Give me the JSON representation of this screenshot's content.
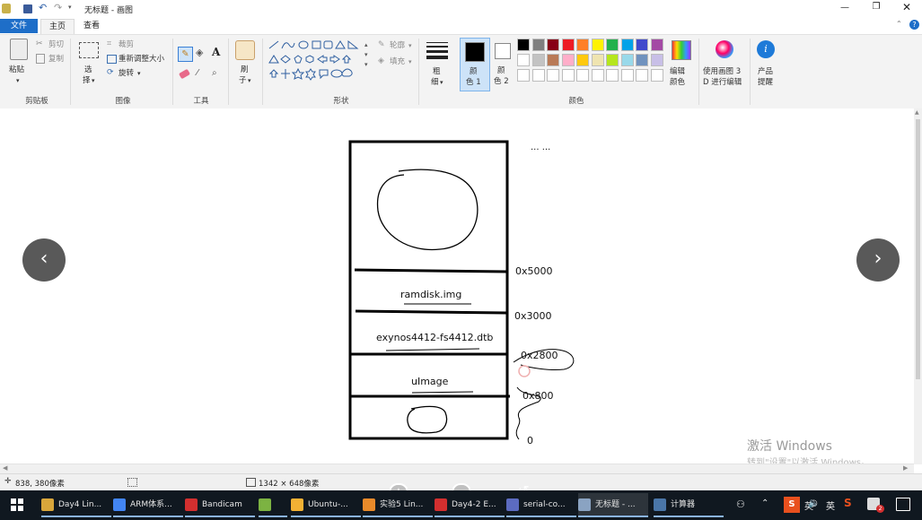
{
  "window": {
    "title": "无标题 - 画图"
  },
  "tabs": [
    {
      "label": "文件"
    },
    {
      "label": "主页"
    },
    {
      "label": "查看"
    }
  ],
  "ribbon": {
    "clipboard": {
      "paste": "粘贴",
      "cut": "剪切",
      "copy": "复制",
      "group": "剪贴板"
    },
    "image": {
      "select_line1": "选",
      "select_line2": "择",
      "crop": "裁剪",
      "resize": "重新调整大小",
      "rotate": "旋转",
      "group": "图像"
    },
    "tools": {
      "group": "工具"
    },
    "brushes": {
      "line1": "刷",
      "line2": "子"
    },
    "shapes": {
      "outline": "轮廓",
      "fill": "填充",
      "group": "形状"
    },
    "size": {
      "line1": "粗",
      "line2": "细"
    },
    "color1": {
      "line1": "颜",
      "line2": "色 1"
    },
    "color2": {
      "line1": "颜",
      "line2": "色 2"
    },
    "edit_colors": {
      "line1": "编辑",
      "line2": "颜色"
    },
    "paint3d": {
      "line1": "使用画图 3",
      "line2": "D 进行编辑"
    },
    "product_alert": {
      "line1": "产品",
      "line2": "提醒"
    },
    "colors_group": "颜色",
    "palette_row1": [
      "#000000",
      "#7f7f7f",
      "#880015",
      "#ed1c24",
      "#ff7f27",
      "#fff200",
      "#22b14c",
      "#00a2e8",
      "#3f48cc",
      "#a349a4"
    ],
    "palette_row2": [
      "#ffffff",
      "#c3c3c3",
      "#b97a57",
      "#ffaec9",
      "#ffc90e",
      "#efe4b0",
      "#b5e61d",
      "#99d9ea",
      "#7092be",
      "#c8bfe7"
    ]
  },
  "diagram": {
    "dots": "... ...",
    "sections": [
      {
        "label": "ramdisk.img"
      },
      {
        "label": "exynos4412-fs4412.dtb"
      },
      {
        "label": "uImage"
      }
    ],
    "addresses": [
      "0x5000",
      "0x3000",
      "0x2800",
      "0x800",
      "0"
    ]
  },
  "watermark": {
    "line1": "激活 Windows",
    "line2": "转到\"设置\"以激活 Windows。"
  },
  "status": {
    "position": "838, 380像素",
    "canvas_size": "1342 × 648像素"
  },
  "taskbar": {
    "items": [
      {
        "label": "Day4 Lin...",
        "color": "#d9a63b"
      },
      {
        "label": "ARM体系...",
        "color": "#4285f4"
      },
      {
        "label": "Bandicam",
        "color": "#d32f2f"
      },
      {
        "label": "",
        "color": "#7cb342"
      },
      {
        "label": "Ubuntu-...",
        "color": "#f2b134"
      },
      {
        "label": "实验5 Lin...",
        "color": "#e88a2a"
      },
      {
        "label": "Day4-2 E...",
        "color": "#d32f2f"
      },
      {
        "label": "serial-co...",
        "color": "#5c6bc0"
      },
      {
        "label": "无标题 - ...",
        "color": "#8aa3c2"
      },
      {
        "label": "计算器",
        "color": "#4a76a8"
      }
    ],
    "ime": "英",
    "lang": "英",
    "notifications": "2"
  }
}
